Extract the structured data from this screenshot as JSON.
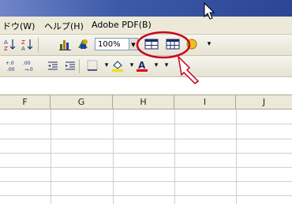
{
  "menubar": {
    "items": [
      "ドウ(W)",
      "ヘルプ(H)",
      "Adobe PDF(B)"
    ]
  },
  "toolbar": {
    "zoom_value": "100%"
  },
  "sheet": {
    "columns": [
      "F",
      "G",
      "H",
      "I",
      "J"
    ]
  },
  "colors": {
    "title_bar": "#2b4694",
    "callout_outline": "#c8001e",
    "toolbar_bg": "#ece9d8"
  }
}
